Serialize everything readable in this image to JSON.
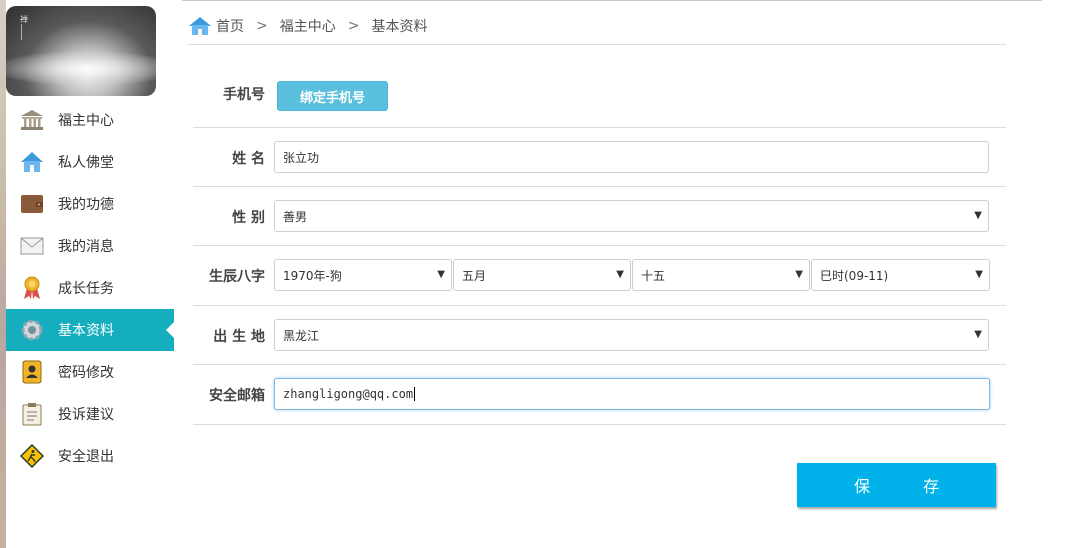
{
  "breadcrumb": {
    "home": "首页",
    "level1": "福主中心",
    "level2": "基本资料"
  },
  "sidebar": {
    "items": [
      {
        "label": "福主中心",
        "icon": "temple-icon"
      },
      {
        "label": "私人佛堂",
        "icon": "house-icon"
      },
      {
        "label": "我的功德",
        "icon": "wallet-icon"
      },
      {
        "label": "我的消息",
        "icon": "envelope-icon"
      },
      {
        "label": "成长任务",
        "icon": "medal-icon"
      },
      {
        "label": "基本资料",
        "icon": "gear-icon",
        "active": true
      },
      {
        "label": "密码修改",
        "icon": "contact-book-icon"
      },
      {
        "label": "投诉建议",
        "icon": "clipboard-icon"
      },
      {
        "label": "安全退出",
        "icon": "exit-sign-icon"
      }
    ]
  },
  "form": {
    "phone": {
      "label": "手机号",
      "button": "绑定手机号"
    },
    "name": {
      "label": "姓 名",
      "value": "张立功"
    },
    "gender": {
      "label": "性 别",
      "value": "善男"
    },
    "birth": {
      "label": "生辰八字",
      "year": "1970年-狗",
      "month": "五月",
      "day": "十五",
      "hour": "巳时(09-11)"
    },
    "birthplace": {
      "label": "出 生 地",
      "value": "黑龙江"
    },
    "email": {
      "label": "安全邮箱",
      "value": "zhangligong@qq.com"
    }
  },
  "save_label": "保 存",
  "colors": {
    "accent": "#14aebf",
    "save": "#00b2e9",
    "bind": "#5bc0de"
  }
}
